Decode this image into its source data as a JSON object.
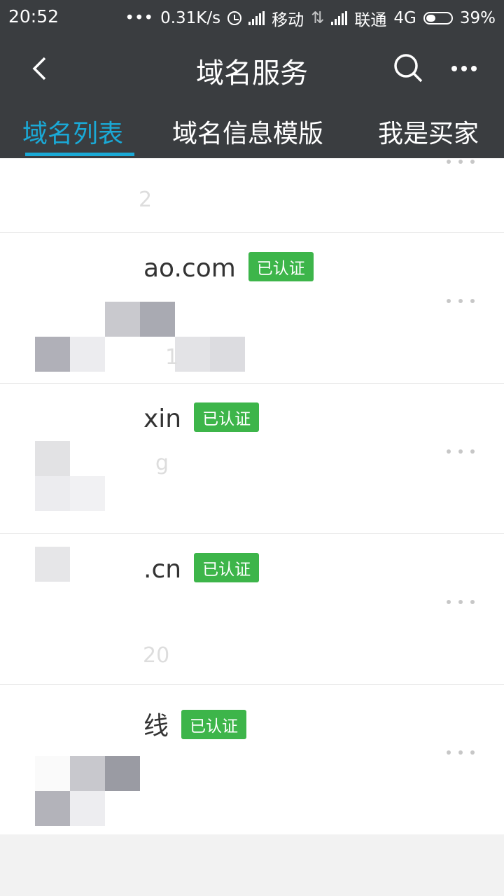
{
  "status_bar": {
    "time": "20:52",
    "dots": "•••",
    "speed": "0.31K/s",
    "carrier1": "移动",
    "carrier2": "联通",
    "network": "4G",
    "battery": "39%",
    "battery_level": 0.39
  },
  "nav": {
    "title": "域名服务",
    "icons": {
      "back": "back-arrow-icon",
      "search": "search-icon",
      "more": "more-icon"
    }
  },
  "tabs": [
    {
      "label": "域名列表",
      "active": true
    },
    {
      "label": "域名信息模版",
      "active": false
    },
    {
      "label": "我是买家",
      "active": false
    }
  ],
  "list": {
    "rows": [
      {
        "domain": "",
        "faint": "2",
        "badge": ""
      },
      {
        "domain": "ao.com",
        "badge": "已认证",
        "faint": "1"
      },
      {
        "domain": "xin",
        "badge": "已认证",
        "faint": "g"
      },
      {
        "domain": ".cn",
        "badge": "已认证",
        "faint": "20"
      },
      {
        "domain": "线",
        "badge": "已认证",
        "faint": ""
      }
    ]
  },
  "colors": {
    "header_bg": "#3a3d40",
    "tab_active": "#1aa9d6",
    "badge_bg": "#3db54a"
  }
}
